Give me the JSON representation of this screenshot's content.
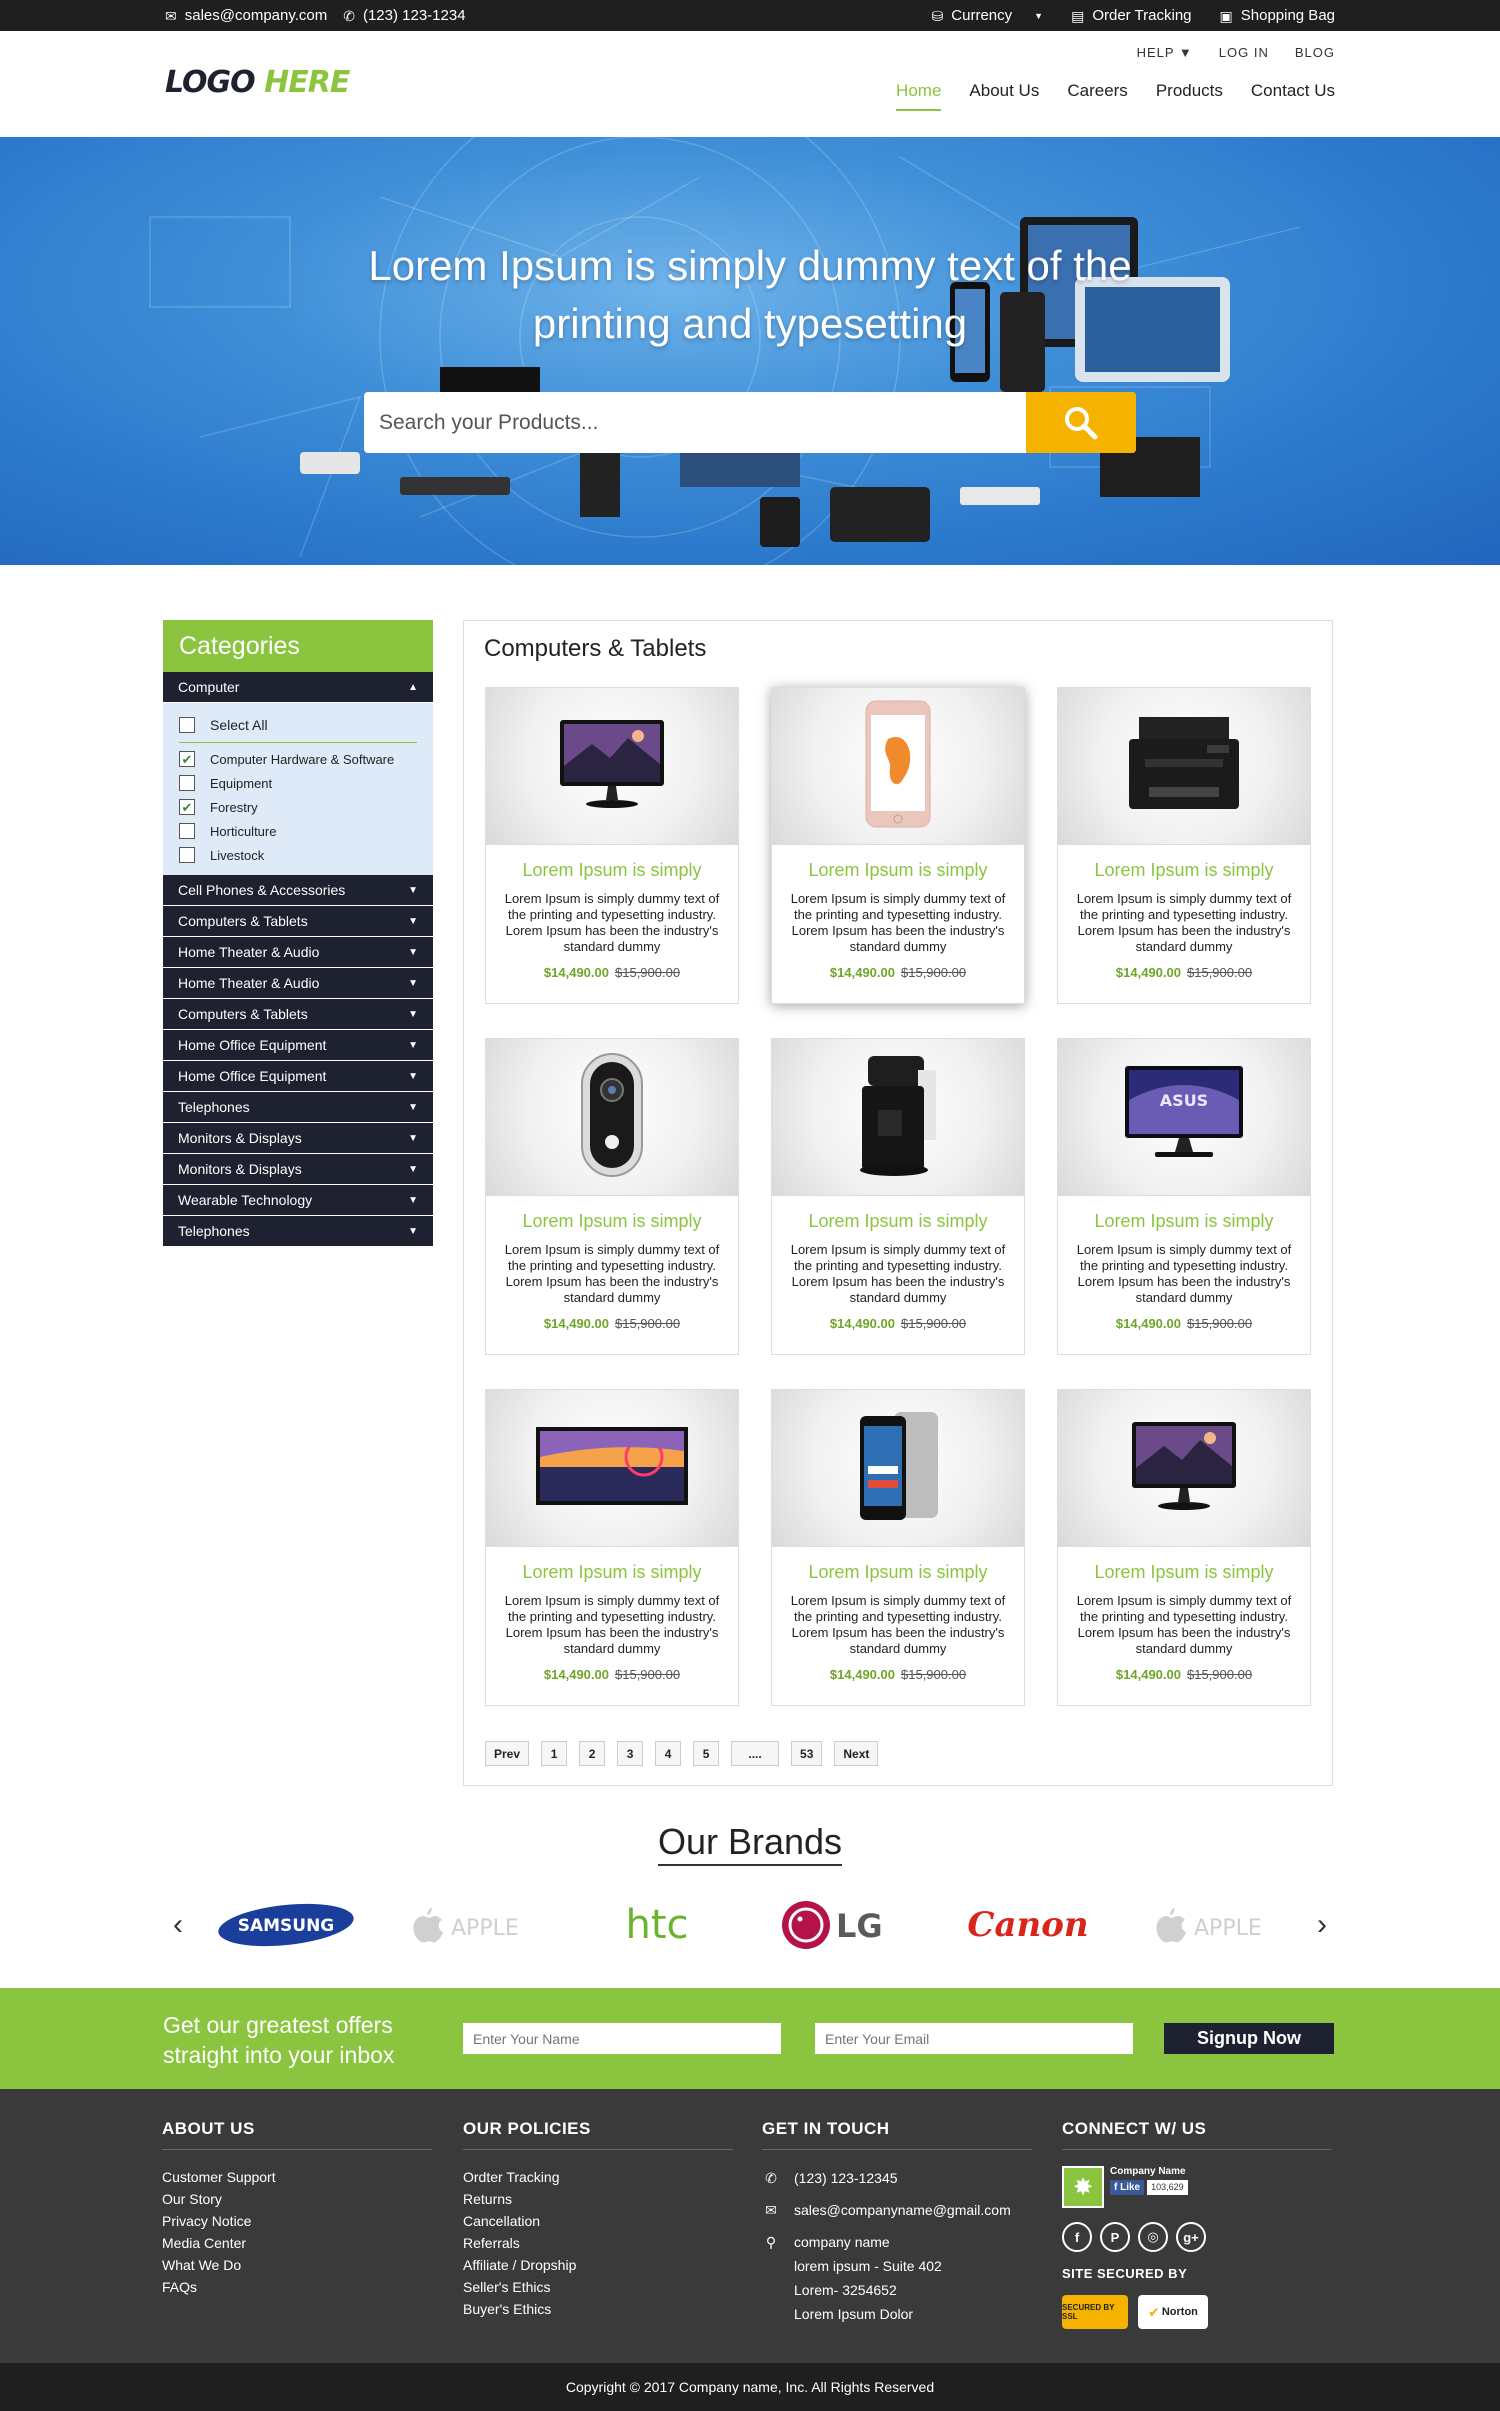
{
  "topbar": {
    "email": "sales@company.com",
    "phone": "(123) 123-1234",
    "currency": "Currency",
    "order_tracking": "Order Tracking",
    "shopping_bag": "Shopping Bag"
  },
  "logo": {
    "part1": "LOGO",
    "part2": "HERE"
  },
  "util_nav": [
    "HELP ▼",
    "LOG IN",
    "BLOG"
  ],
  "main_nav": [
    "Home",
    "About Us",
    "Careers",
    "Products",
    "Contact Us"
  ],
  "hero": {
    "title_line1": "Lorem Ipsum is simply dummy text of the",
    "title_line2": "printing and typesetting",
    "search_placeholder": "Search your Products..."
  },
  "sidebar": {
    "title": "Categories",
    "open_category": "Computer",
    "select_all": "Select All",
    "options": [
      {
        "label": "Computer Hardware & Software",
        "checked": true
      },
      {
        "label": "Equipment",
        "checked": false
      },
      {
        "label": "Forestry",
        "checked": true
      },
      {
        "label": "Horticulture",
        "checked": false
      },
      {
        "label": "Livestock",
        "checked": false
      }
    ],
    "categories": [
      "Cell Phones & Accessories",
      "Computers & Tablets",
      "Home Theater & Audio",
      "Home Theater & Audio",
      "Computers & Tablets",
      "Home Office Equipment",
      "Home Office Equipment",
      "Telephones",
      "Monitors & Displays",
      "Monitors & Displays",
      "Wearable Technology",
      "Telephones"
    ]
  },
  "products": {
    "title": "Computers & Tablets",
    "items": [
      {
        "title": "Lorem Ipsum is simply",
        "desc": "Lorem Ipsum is simply dummy text of the printing and typesetting industry. Lorem Ipsum has been the industry's standard dummy",
        "price": "$14,490.00",
        "old_price": "$15,900.00",
        "image": "monitor-icon"
      },
      {
        "title": "Lorem Ipsum is simply",
        "desc": "Lorem Ipsum is simply dummy text of the printing and typesetting industry. Lorem Ipsum has been the industry's standard dummy",
        "price": "$14,490.00",
        "old_price": "$15,900.00",
        "image": "phone-icon"
      },
      {
        "title": "Lorem Ipsum is simply",
        "desc": "Lorem Ipsum is simply dummy text of the printing and typesetting industry. Lorem Ipsum has been the industry's standard dummy",
        "price": "$14,490.00",
        "old_price": "$15,900.00",
        "image": "printer-icon"
      },
      {
        "title": "Lorem Ipsum is simply",
        "desc": "Lorem Ipsum is simply dummy text of the printing and typesetting industry. Lorem Ipsum has been the industry's standard dummy",
        "price": "$14,490.00",
        "old_price": "$15,900.00",
        "image": "doorbell-camera-icon"
      },
      {
        "title": "Lorem Ipsum is simply",
        "desc": "Lorem Ipsum is simply dummy text of the printing and typesetting industry. Lorem Ipsum has been the industry's standard dummy",
        "price": "$14,490.00",
        "old_price": "$15,900.00",
        "image": "coffee-maker-icon"
      },
      {
        "title": "Lorem Ipsum is simply",
        "desc": "Lorem Ipsum is simply dummy text of the printing and typesetting industry. Lorem Ipsum has been the industry's standard dummy",
        "price": "$14,490.00",
        "old_price": "$15,900.00",
        "image": "asus-monitor-icon"
      },
      {
        "title": "Lorem Ipsum is simply",
        "desc": "Lorem Ipsum is simply dummy text of the printing and typesetting industry. Lorem Ipsum has been the industry's standard dummy",
        "price": "$14,490.00",
        "old_price": "$15,900.00",
        "image": "tv-icon"
      },
      {
        "title": "Lorem Ipsum is simply",
        "desc": "Lorem Ipsum is simply dummy text of the printing and typesetting industry. Lorem Ipsum has been the industry's standard dummy",
        "price": "$14,490.00",
        "old_price": "$15,900.00",
        "image": "smartphones-icon"
      },
      {
        "title": "Lorem Ipsum is simply",
        "desc": "Lorem Ipsum is simply dummy text of the printing and typesetting industry. Lorem Ipsum has been the industry's standard dummy",
        "price": "$14,490.00",
        "old_price": "$15,900.00",
        "image": "monitor-icon"
      }
    ],
    "pagination": [
      "Prev",
      "1",
      "2",
      "3",
      "4",
      "5",
      "....",
      "53",
      "Next"
    ]
  },
  "brands": {
    "title": "Our Brands",
    "items": [
      "SAMSUNG",
      "APPLE",
      "htc",
      "LG",
      "Canon",
      "APPLE"
    ]
  },
  "newsletter": {
    "line1": "Get our greatest offers",
    "line2": "straight into your inbox",
    "name_placeholder": "Enter Your Name",
    "email_placeholder": "Enter Your Email",
    "button": "Signup Now"
  },
  "footer": {
    "about": {
      "title": "ABOUT US",
      "links": [
        "Customer Support",
        "Our Story",
        "Privacy Notice",
        "Media Center",
        "What We Do",
        "FAQs"
      ]
    },
    "policies": {
      "title": "OUR POLICIES",
      "links": [
        "Ordter Tracking",
        "Returns",
        "Cancellation",
        "Referrals",
        "Affiliate / Dropship",
        "Seller's Ethics",
        "Buyer's Ethics"
      ]
    },
    "contact": {
      "title": "GET IN TOUCH",
      "phone": "(123) 123-12345",
      "email": "sales@companyname@gmail.com",
      "address": [
        "company name",
        "lorem ipsum - Suite 402",
        "Lorem- 3254652",
        "Lorem Ipsum Dolor"
      ]
    },
    "connect": {
      "title": "CONNECT W/ US",
      "company": "Company Name",
      "like": "Like",
      "like_count": "103,629",
      "secured_by": "SITE SECURED BY",
      "badge1": "SECURED BY SSL",
      "badge2": "Norton"
    }
  },
  "copyright": "Copyright © 2017 Company name, Inc. All Rights Reserved",
  "colors": {
    "accent": "#8bc53f",
    "dark": "#1d2130",
    "search_button": "#f5b300",
    "hero": "#2b78cb"
  }
}
